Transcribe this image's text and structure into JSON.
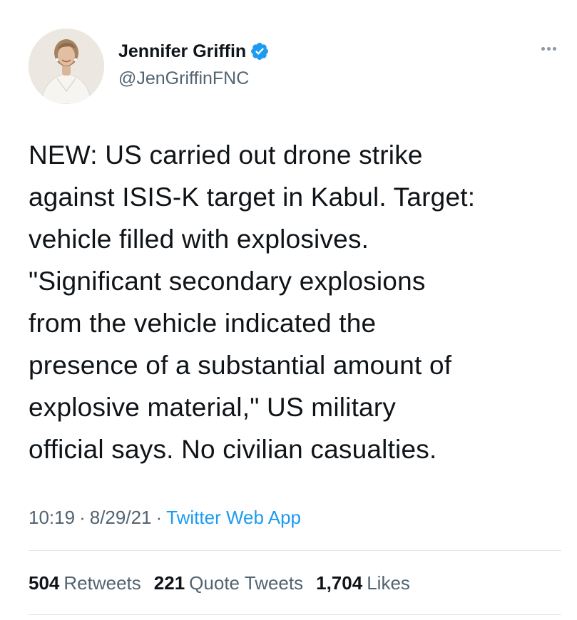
{
  "author": {
    "name": "Jennifer Griffin",
    "handle": "@JenGriffinFNC",
    "verified": true
  },
  "tweet": {
    "text": "NEW: US carried out drone strike\nagainst ISIS-K target in Kabul. Target:\nvehicle filled with explosives.\n\"Significant secondary explosions\nfrom the vehicle indicated the\npresence of a substantial amount of\nexplosive material,\" US military\nofficial says. No civilian casualties."
  },
  "meta": {
    "time": "10:19",
    "separator1": "·",
    "date": "8/29/21",
    "separator2": "·",
    "source": "Twitter Web App"
  },
  "stats": {
    "retweets_count": "504",
    "retweets_label": "Retweets",
    "quotes_count": "221",
    "quotes_label": "Quote Tweets",
    "likes_count": "1,704",
    "likes_label": "Likes"
  },
  "colors": {
    "accent": "#1d9bf0",
    "text_primary": "#0f1419",
    "text_secondary": "#536471",
    "divider": "#e1e6ea"
  },
  "icons": {
    "verified": "verified-badge-icon",
    "more": "more-options-icon"
  }
}
